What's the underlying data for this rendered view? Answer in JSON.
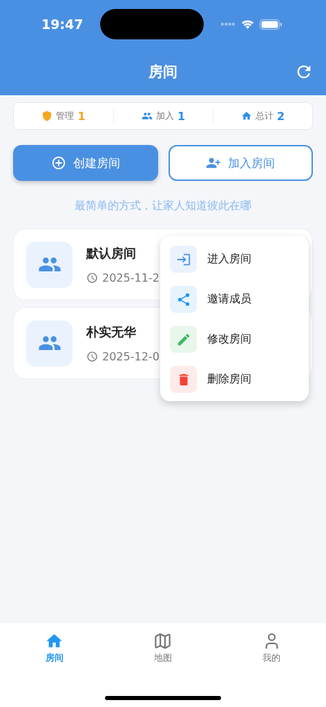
{
  "status_bar": {
    "time": "19:47"
  },
  "header": {
    "title": "房间"
  },
  "stats": [
    {
      "kind": "manage",
      "label": "管理",
      "count": "1",
      "color": "#f5a623"
    },
    {
      "kind": "join",
      "label": "加入",
      "count": "1",
      "color": "#2f8ee8"
    },
    {
      "kind": "total",
      "label": "总计",
      "count": "2",
      "color": "#2f8ee8"
    }
  ],
  "actions": [
    {
      "kind": "create",
      "label": "创建房间"
    },
    {
      "kind": "join",
      "label": "加入房间"
    }
  ],
  "tagline": "最简单的方式，让家人知道彼此在哪",
  "rooms": [
    {
      "name": "默认房间",
      "date": "2025-11-2"
    },
    {
      "name": "朴实无华",
      "date": "2025-12-0"
    }
  ],
  "menu": [
    {
      "kind": "enter",
      "label": "进入房间"
    },
    {
      "kind": "invite",
      "label": "邀请成员"
    },
    {
      "kind": "edit",
      "label": "修改房间"
    },
    {
      "kind": "delete",
      "label": "删除房间"
    }
  ],
  "tab_bar": [
    {
      "kind": "home",
      "label": "房间",
      "selected": true
    },
    {
      "kind": "map",
      "label": "地图",
      "selected": false
    },
    {
      "kind": "profile",
      "label": "我的",
      "selected": false
    }
  ]
}
